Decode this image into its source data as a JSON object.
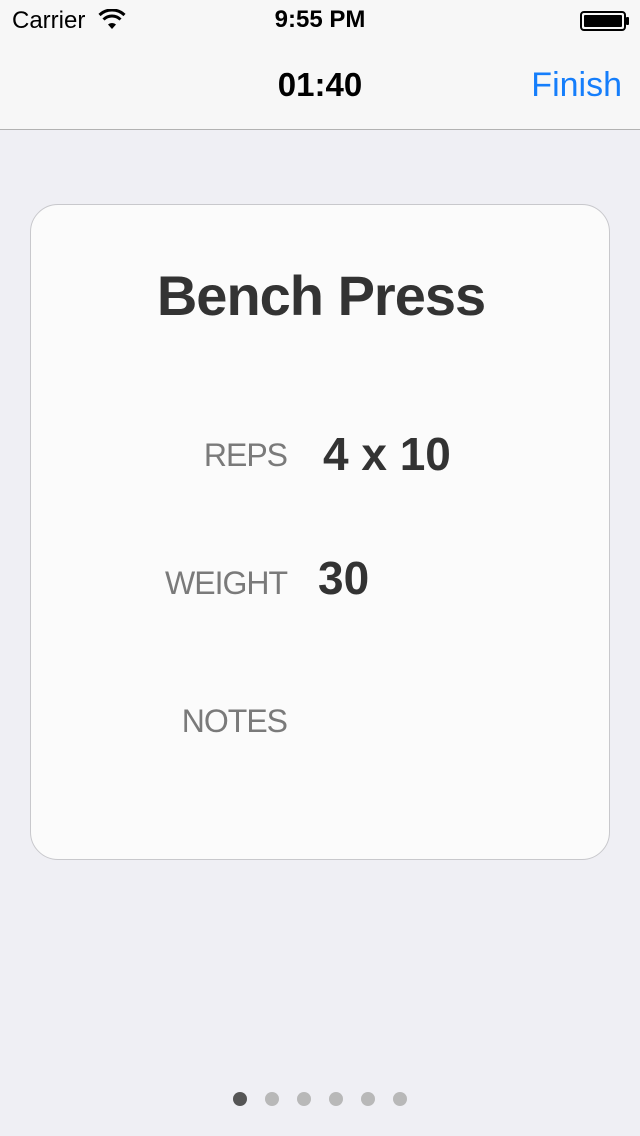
{
  "status_bar": {
    "carrier": "Carrier",
    "time": "9:55 PM",
    "wifi_icon": "wifi-icon",
    "battery_icon": "battery-icon"
  },
  "nav_bar": {
    "title": "01:40",
    "finish_label": "Finish",
    "accent_color": "#157efb"
  },
  "card": {
    "exercise_name": "Bench Press",
    "fields": {
      "reps": {
        "label": "REPS",
        "value": "4 x 10"
      },
      "weight": {
        "label": "WEIGHT",
        "value": "30"
      },
      "notes": {
        "label": "NOTES",
        "value": ""
      }
    }
  },
  "page_control": {
    "total_pages": 6,
    "current_page": 1
  }
}
